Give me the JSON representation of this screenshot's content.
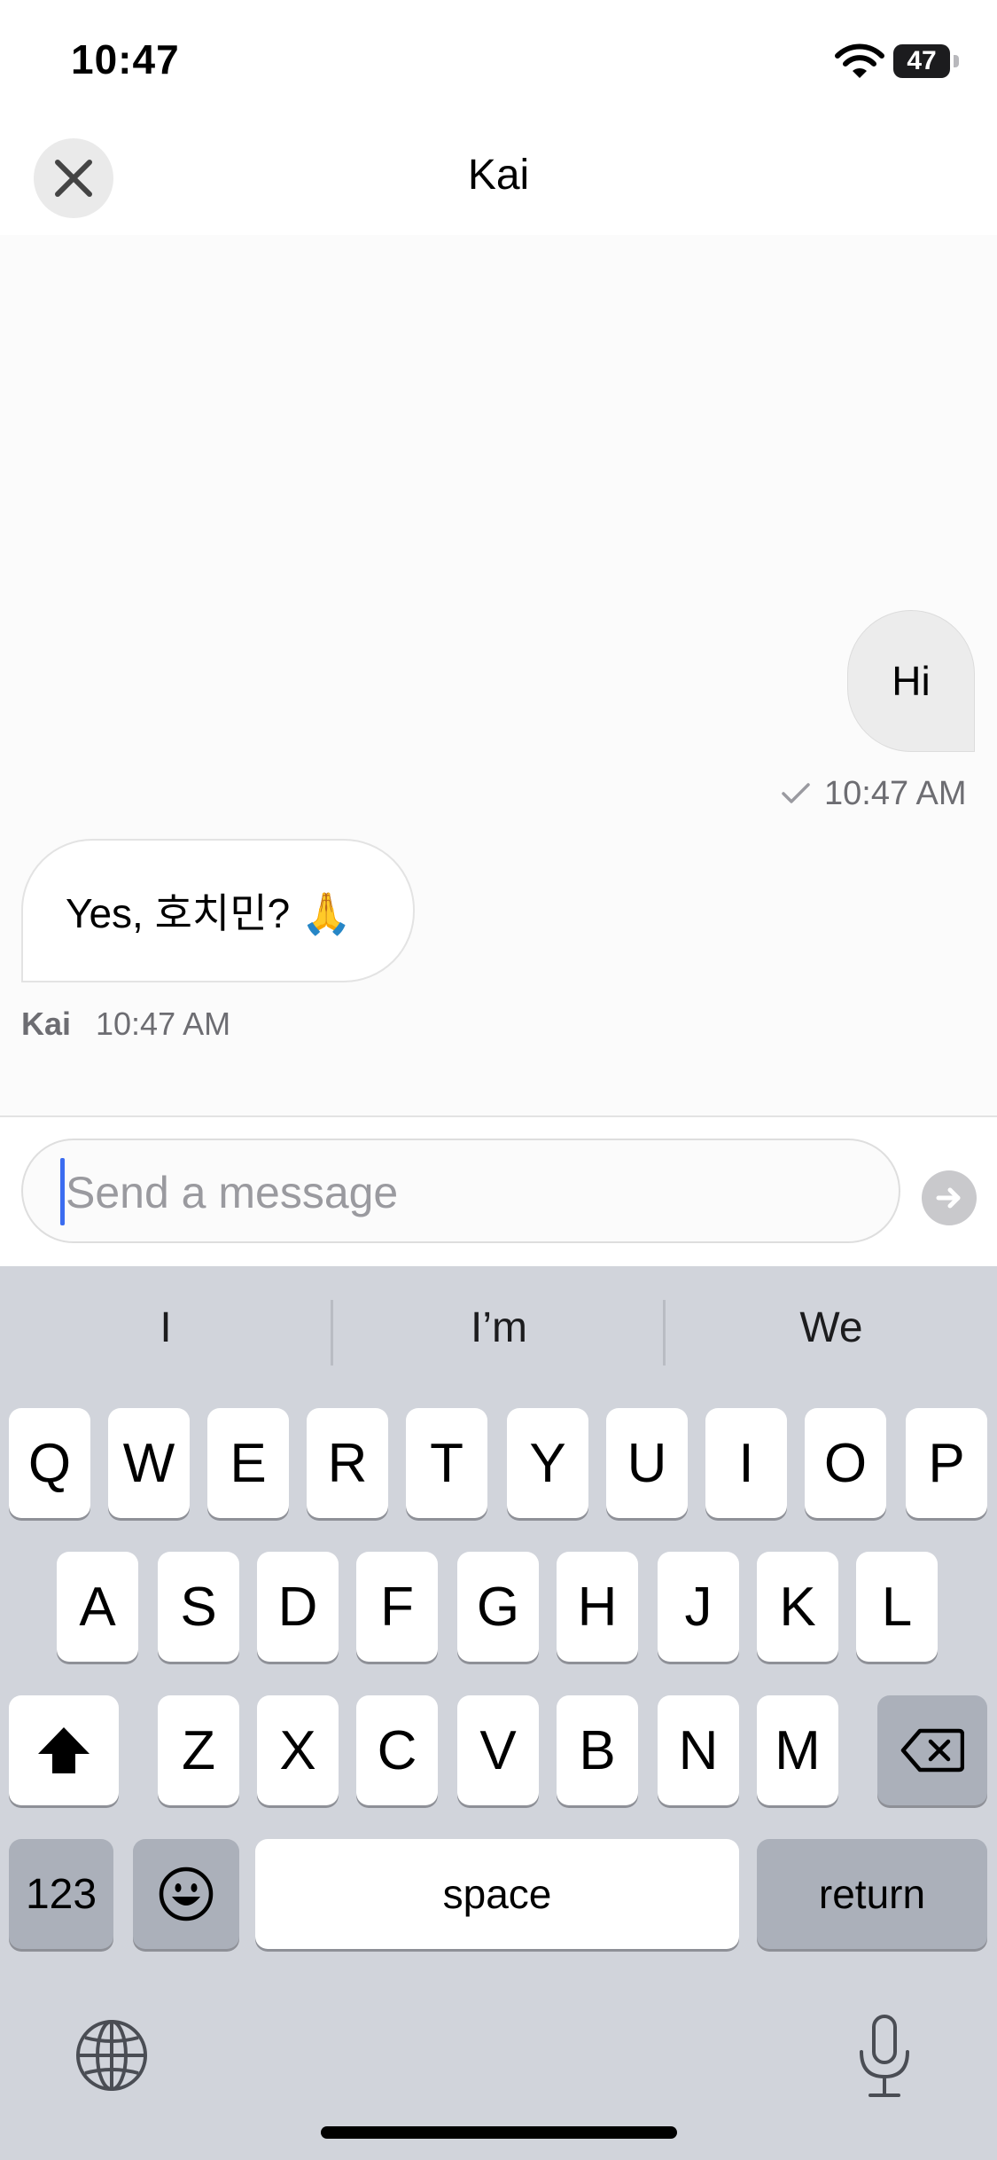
{
  "status_bar": {
    "time": "10:47",
    "battery": "47"
  },
  "header": {
    "title": "Kai"
  },
  "messages": {
    "outgoing": {
      "text": "Hi",
      "time": "10:47 AM"
    },
    "incoming": {
      "text": "Yes, 호치민? 🙏",
      "sender": "Kai",
      "time": "10:47 AM"
    }
  },
  "composer": {
    "placeholder": "Send a message",
    "value": ""
  },
  "keyboard": {
    "suggestions": [
      "I",
      "I’m",
      "We"
    ],
    "row1": [
      "Q",
      "W",
      "E",
      "R",
      "T",
      "Y",
      "U",
      "I",
      "O",
      "P"
    ],
    "row2": [
      "A",
      "S",
      "D",
      "F",
      "G",
      "H",
      "J",
      "K",
      "L"
    ],
    "row3": [
      "Z",
      "X",
      "C",
      "V",
      "B",
      "N",
      "M"
    ],
    "numbers_label": "123",
    "space_label": "space",
    "return_label": "return"
  },
  "icons": {
    "close": "close-icon",
    "send": "arrow-right-icon",
    "check": "check-icon",
    "shift": "shift-icon",
    "delete": "delete-icon",
    "emoji": "emoji-icon",
    "globe": "globe-icon",
    "microphone": "microphone-icon"
  }
}
